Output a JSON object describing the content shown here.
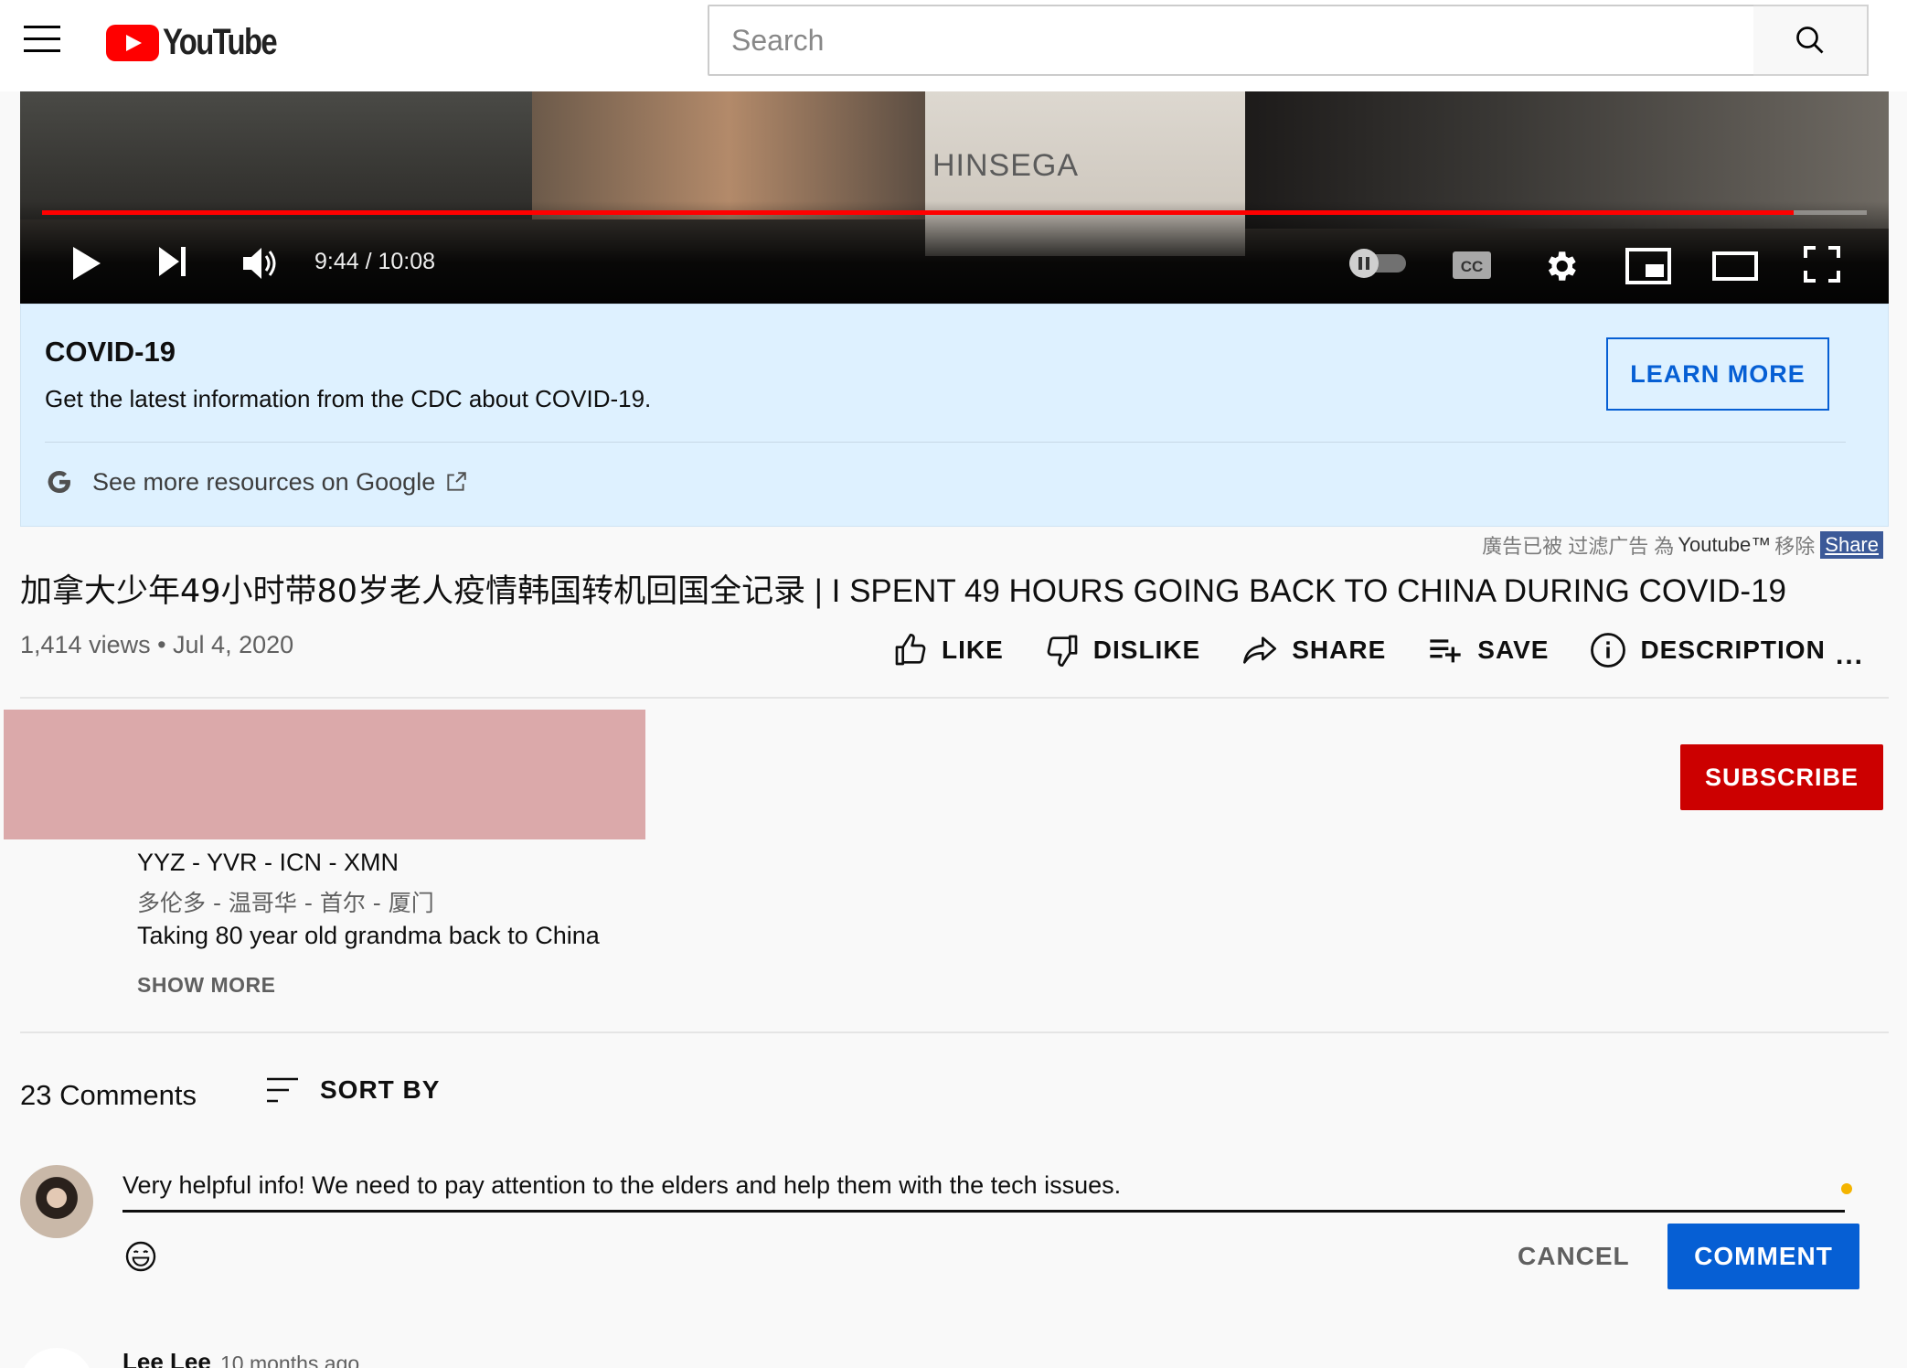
{
  "header": {
    "logo_text": "YouTube",
    "search_placeholder": "Search"
  },
  "player": {
    "time_display": "9:44 / 10:08",
    "progress_fraction": 0.96,
    "overlay_text": "HINSEGA"
  },
  "covid_panel": {
    "title": "COVID-19",
    "description": "Get the latest information from the CDC about COVID-19.",
    "learn_more_label": "LEARN MORE",
    "google_link_label": "See more resources on Google"
  },
  "ad_note": {
    "text_before": "廣告已被 过滤广告 為",
    "brand": "Youtube™",
    "text_after": "移除",
    "share_label": "Share"
  },
  "video": {
    "title_cn": "加拿大少年49小时带80岁老人疫情韩国转机回国全记录",
    "title_en": " | I SPENT 49 HOURS GOING BACK TO CHINA DURING COVID-19",
    "meta": "1,414 views • Jul 4, 2020"
  },
  "actions": {
    "like": "LIKE",
    "dislike": "DISLIKE",
    "share": "SHARE",
    "save": "SAVE",
    "description": "DESCRIPTION",
    "more": "..."
  },
  "channel": {
    "subscribe_label": "SUBSCRIBE"
  },
  "description_lines": {
    "route": "YYZ - YVR - ICN - XMN",
    "route_cn": "多伦多 - 温哥华 - 首尔 - 厦门",
    "summary": "Taking 80 year old grandma back to China",
    "show_more": "SHOW MORE"
  },
  "comments": {
    "count_label": "23 Comments",
    "sort_label": "SORT BY",
    "input_value": "Very helpful info! We need to pay attention to the elders and help them with the tech issues.",
    "cancel_label": "CANCEL",
    "comment_label": "COMMENT",
    "next_author": "Lee Lee",
    "next_time": "10 months ago"
  },
  "colors": {
    "brand_red": "#ff0000",
    "subscribe_red": "#cc0000",
    "link_blue": "#065fd4",
    "covid_bg": "#def1ff"
  }
}
